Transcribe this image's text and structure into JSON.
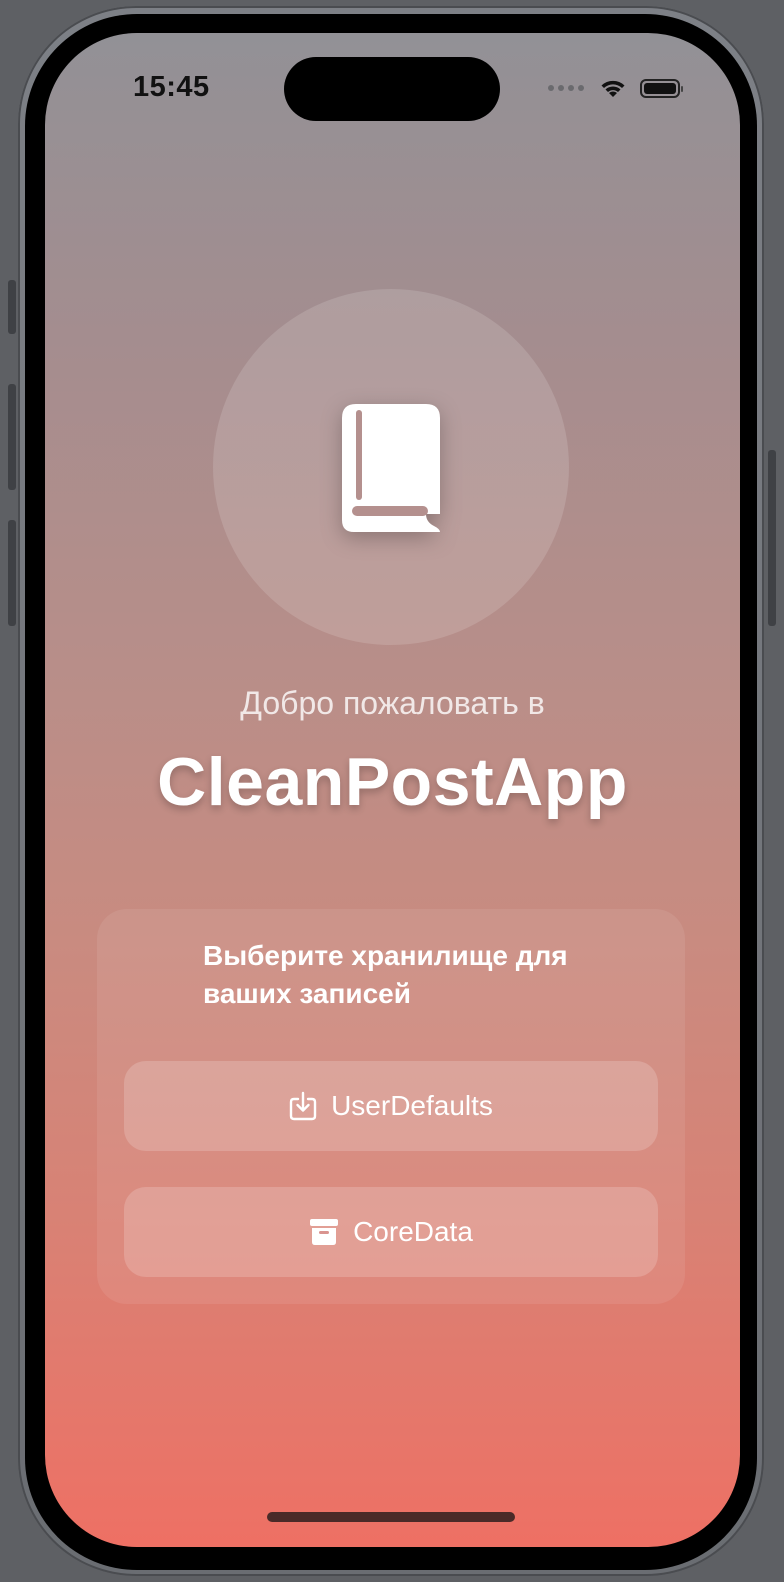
{
  "status_bar": {
    "time": "15:45",
    "icons": [
      "signal-dots-icon",
      "wifi-icon",
      "battery-icon"
    ]
  },
  "hero": {
    "icon": "book-icon",
    "welcome_text": "Добро пожаловать в",
    "app_name": "CleanPostApp"
  },
  "storage_card": {
    "heading": "Выберите хранилище для ваших записей",
    "options": [
      {
        "label": "UserDefaults",
        "icon": "download-tray-icon"
      },
      {
        "label": "CoreData",
        "icon": "archive-box-icon"
      }
    ]
  },
  "colors": {
    "gradient_top": "#929196",
    "gradient_bottom": "#ee7064",
    "text": "#ffffff"
  }
}
